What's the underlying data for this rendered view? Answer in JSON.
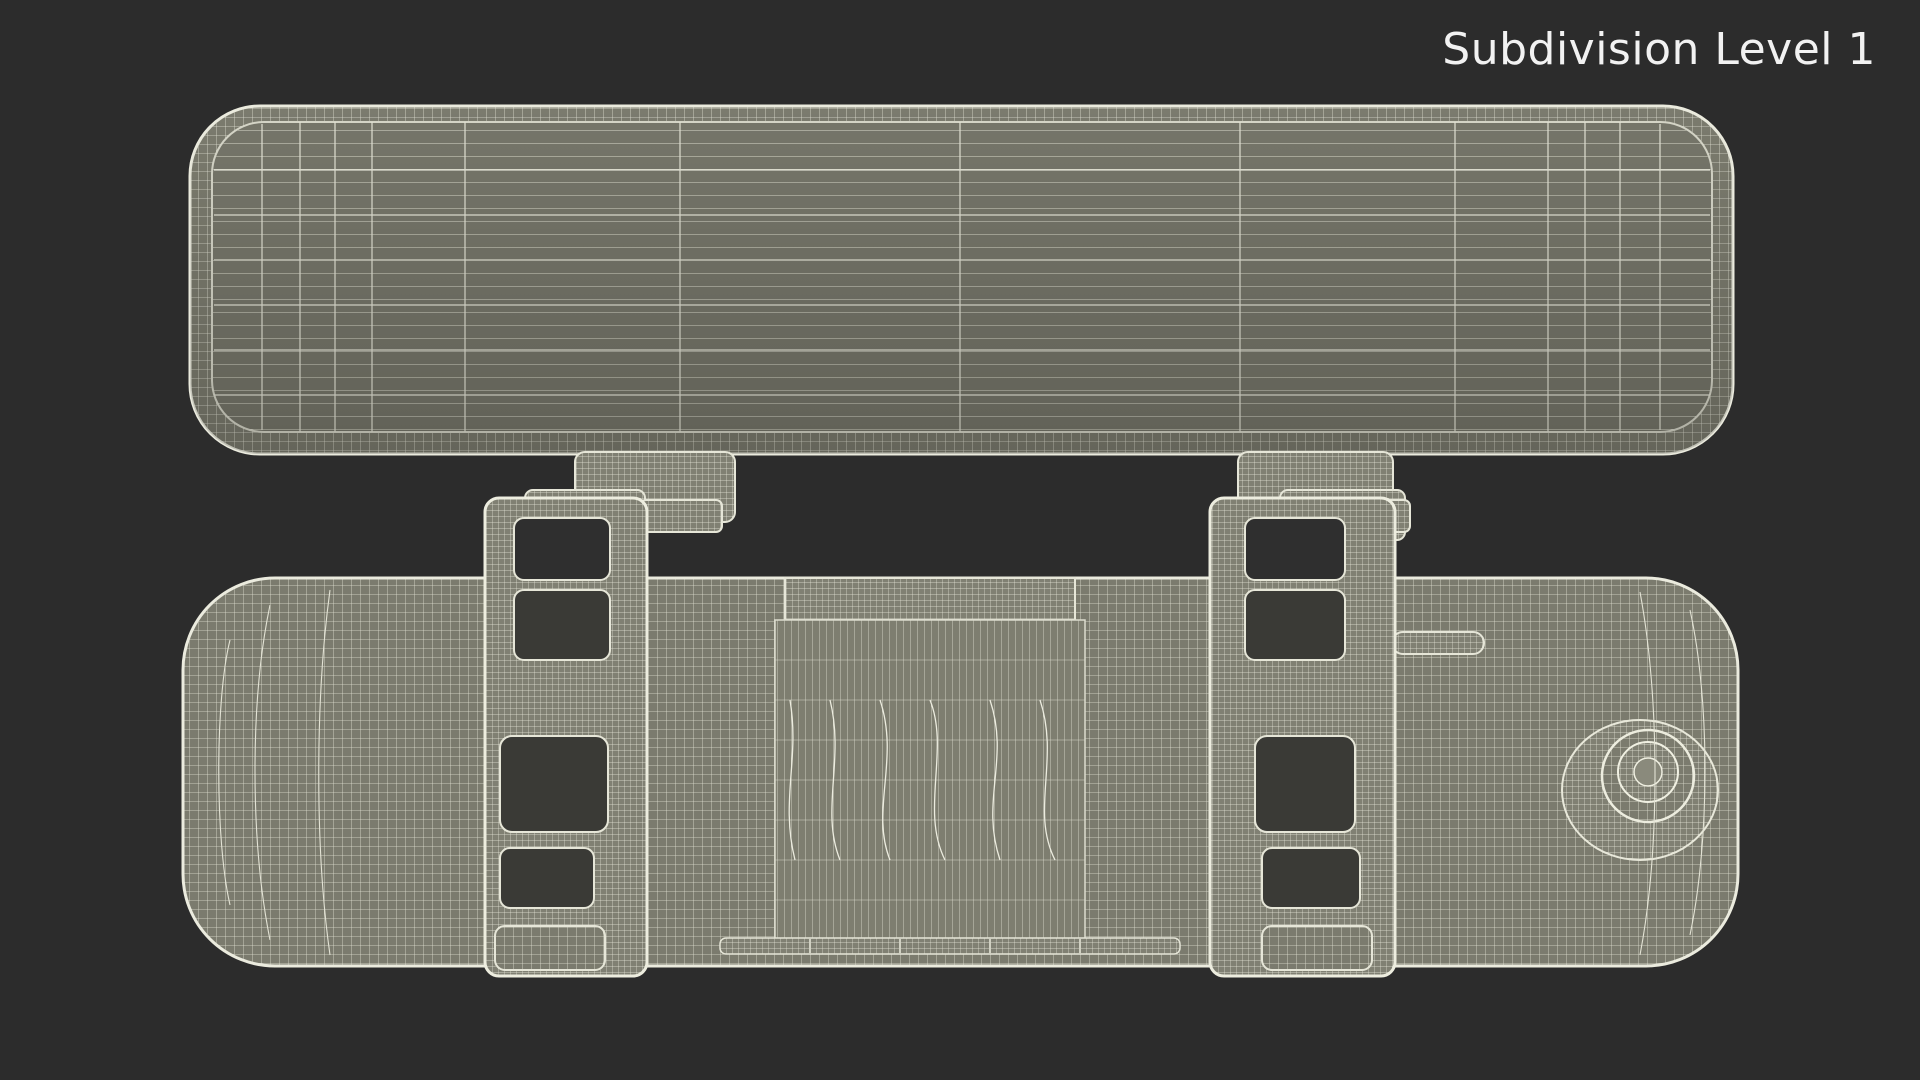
{
  "label": {
    "text": "Subdivision Level 1"
  },
  "render": {
    "background_color": "#2c2c2c",
    "mesh_fill_color": "#7a7a6c",
    "wire_color": "#e6e6d8",
    "shadow_color": "#5a5a4e"
  }
}
